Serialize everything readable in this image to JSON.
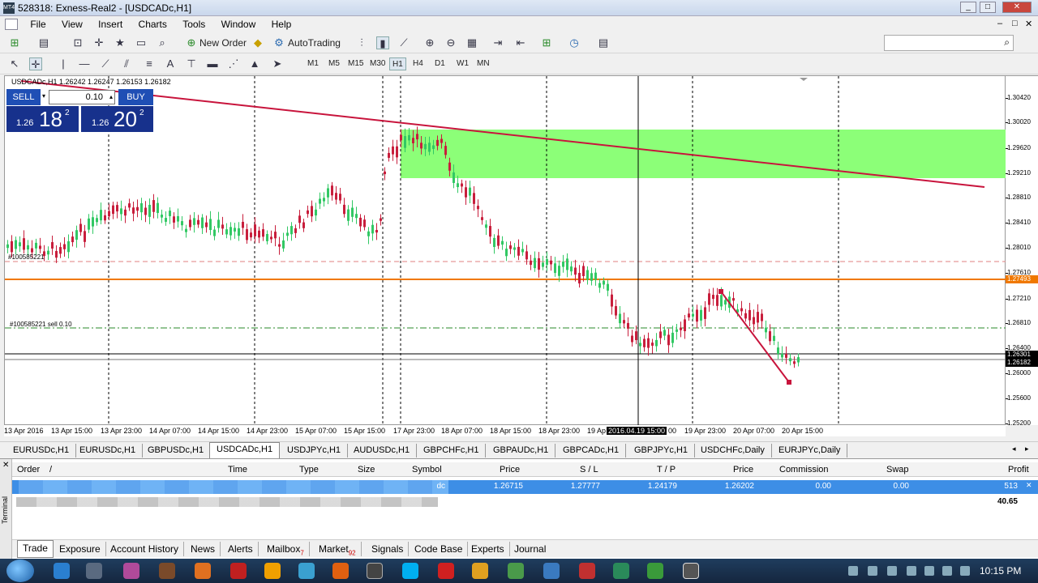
{
  "window": {
    "title": "528318: Exness-Real2 - [USDCADc,H1]",
    "app_badge": "MT4"
  },
  "menu": [
    "File",
    "View",
    "Insert",
    "Charts",
    "Tools",
    "Window",
    "Help"
  ],
  "toolbar": {
    "new_order": "New Order",
    "auto_trading": "AutoTrading"
  },
  "timeframes": [
    "M1",
    "M5",
    "M15",
    "M30",
    "H1",
    "H4",
    "D1",
    "W1",
    "MN"
  ],
  "active_timeframe": "H1",
  "chart": {
    "title": "USDCADc,H1  1.26242 1.26247 1.26153 1.26182",
    "symbol": "USDCADc",
    "order_line_label": "#100585221 sell 0.10",
    "order_line_label2": "#100585221",
    "one_click": {
      "sell": "SELL",
      "buy": "BUY",
      "lot": "0.10",
      "sell_prefix": "1.26",
      "sell_big": "18",
      "sell_sup": "2",
      "buy_prefix": "1.26",
      "buy_big": "20",
      "buy_sup": "2"
    },
    "price_labels": [
      "1.30420",
      "1.30020",
      "1.29620",
      "1.29210",
      "1.28810",
      "1.28410",
      "1.28010",
      "1.27610",
      "1.27210",
      "1.26810",
      "1.26400",
      "1.26000",
      "1.25600",
      "1.25200"
    ],
    "price_tags": {
      "orange": "1.27493",
      "ask": "1.26301",
      "bid": "1.26182"
    },
    "time_labels": [
      "13 Apr 2016",
      "13 Apr 15:00",
      "13 Apr 23:00",
      "14 Apr 07:00",
      "14 Apr 15:00",
      "14 Apr 23:00",
      "15 Apr 07:00",
      "15 Apr 15:00",
      "17 Apr 23:00",
      "18 Apr 07:00",
      "18 Apr 15:00",
      "18 Apr 23:00",
      "19 Ap",
      "2016.04.19 15:00",
      "00",
      "19 Apr 23:00",
      "20 Apr 07:00",
      "20 Apr 15:00"
    ],
    "colors": {
      "up": "#32c864",
      "down": "#c81e3c",
      "zone": "#8cff78",
      "trend": "#c8143c",
      "hline": "#f07800"
    }
  },
  "chart_tabs": [
    "EURUSDc,H1",
    "EURUSDc,H1",
    "GBPUSDc,H1",
    "USDCADc,H1",
    "USDJPYc,H1",
    "AUDUSDc,H1",
    "GBPCHFc,H1",
    "GBPAUDc,H1",
    "GBPCADc,H1",
    "GBPJPYc,H1",
    "USDCHFc,Daily",
    "EURJPYc,Daily"
  ],
  "active_chart_tab": "USDCADc,H1",
  "terminal": {
    "side_label": "Terminal",
    "columns": [
      "Order",
      "/",
      "Time",
      "Type",
      "Size",
      "Symbol",
      "Price",
      "S / L",
      "T / P",
      "Price",
      "Commission",
      "Swap",
      "Profit"
    ],
    "row": {
      "symbol_tail": "dc",
      "price": "1.26715",
      "sl": "1.27777",
      "tp": "1.24179",
      "cur_price": "1.26202",
      "commission": "0.00",
      "swap": "0.00",
      "profit": "513"
    },
    "balance": "40.65",
    "tabs": [
      "Trade",
      "Exposure",
      "Account History",
      "News",
      "Alerts",
      "Mailbox",
      "Market",
      "Signals",
      "Code Base",
      "Experts",
      "Journal"
    ],
    "mailbox_count": "7",
    "market_count": "92"
  },
  "taskbar": {
    "clock": "10:15 PM"
  }
}
